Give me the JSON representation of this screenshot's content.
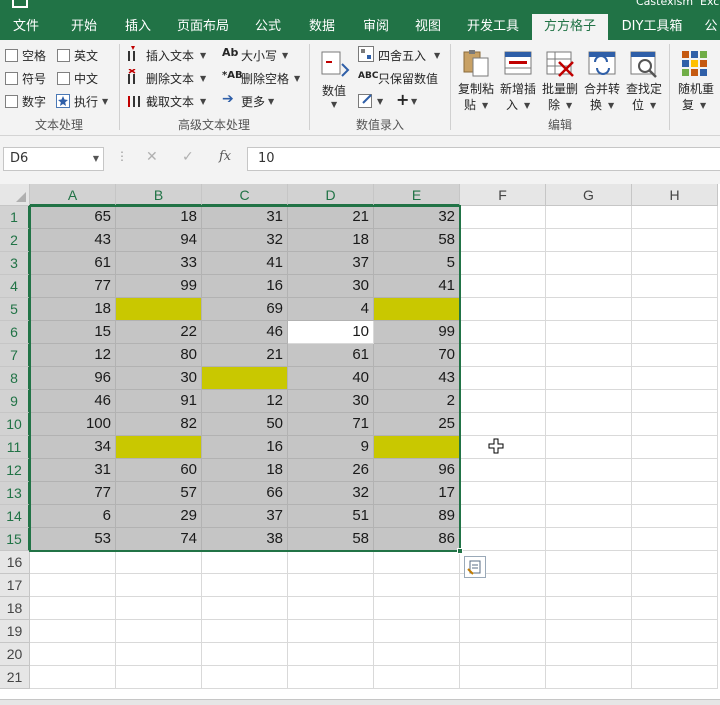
{
  "titlebar": {
    "title_fragment": "Castexism",
    "suffix": "Exc"
  },
  "ribbon": {
    "tabs": [
      {
        "label": "文件",
        "active": false
      },
      {
        "label": "开始",
        "active": false
      },
      {
        "label": "插入",
        "active": false
      },
      {
        "label": "页面布局",
        "active": false
      },
      {
        "label": "公式",
        "active": false
      },
      {
        "label": "数据",
        "active": false
      },
      {
        "label": "审阅",
        "active": false
      },
      {
        "label": "视图",
        "active": false
      },
      {
        "label": "开发工具",
        "active": false
      },
      {
        "label": "方方格子",
        "active": true
      },
      {
        "label": "DIY工具箱",
        "active": false
      },
      {
        "label": "公",
        "active": false
      }
    ],
    "text_group": {
      "label": "文本处理",
      "checkboxes": [
        "空格",
        "英文",
        "符号",
        "中文",
        "数字"
      ],
      "exec_label": "执行"
    },
    "advanced_group": {
      "label": "高级文本处理",
      "insert_text": "插入文本",
      "delete_text": "删除文本",
      "extract_text": "截取文本",
      "case": "大小写",
      "delete_space": "删除空格",
      "more": "更多"
    },
    "numeric_group": {
      "label": "数值录入",
      "numeric": "数值",
      "round": "四舍五入",
      "keep_values": "只保留数值"
    },
    "edit_group": {
      "label": "编辑",
      "buttons": [
        {
          "line1": "复制粘",
          "line2": "贴"
        },
        {
          "line1": "新增插",
          "line2": "入"
        },
        {
          "line1": "批量删",
          "line2": "除"
        },
        {
          "line1": "合并转",
          "line2": "换"
        },
        {
          "line1": "查找定",
          "line2": "位"
        }
      ]
    },
    "random_group": {
      "line1": "随机重",
      "line2": "复"
    }
  },
  "formula_bar": {
    "name_box": "D6",
    "formula": "10",
    "fx_label": "fx"
  },
  "columns": [
    "A",
    "B",
    "C",
    "D",
    "E",
    "F",
    "G",
    "H"
  ],
  "rows": [
    "1",
    "2",
    "3",
    "4",
    "5",
    "6",
    "7",
    "8",
    "9",
    "10",
    "11",
    "12",
    "13",
    "14",
    "15",
    "16",
    "17",
    "18",
    "19",
    "20",
    "21"
  ],
  "cells": [
    [
      "65",
      "18",
      "31",
      "21",
      "32"
    ],
    [
      "43",
      "94",
      "32",
      "18",
      "58"
    ],
    [
      "61",
      "33",
      "41",
      "37",
      "5"
    ],
    [
      "77",
      "99",
      "16",
      "30",
      "41"
    ],
    [
      "18",
      "",
      "69",
      "4",
      ""
    ],
    [
      "15",
      "22",
      "46",
      "10",
      "99"
    ],
    [
      "12",
      "80",
      "21",
      "61",
      "70"
    ],
    [
      "96",
      "30",
      "",
      "40",
      "43"
    ],
    [
      "46",
      "91",
      "12",
      "30",
      "2"
    ],
    [
      "100",
      "82",
      "50",
      "71",
      "25"
    ],
    [
      "34",
      "",
      "16",
      "9",
      ""
    ],
    [
      "31",
      "60",
      "18",
      "26",
      "96"
    ],
    [
      "77",
      "57",
      "66",
      "32",
      "17"
    ],
    [
      "6",
      "29",
      "37",
      "51",
      "89"
    ],
    [
      "53",
      "74",
      "38",
      "58",
      "86"
    ]
  ],
  "highlighted_cells": [
    [
      4,
      1
    ],
    [
      4,
      4
    ],
    [
      7,
      2
    ],
    [
      10,
      1
    ],
    [
      10,
      4
    ]
  ],
  "active_cell": [
    5,
    3
  ],
  "colors": {
    "excel_green": "#217346",
    "selection_gray": "#c5c5c5",
    "highlight_yellow": "#c9c800"
  }
}
